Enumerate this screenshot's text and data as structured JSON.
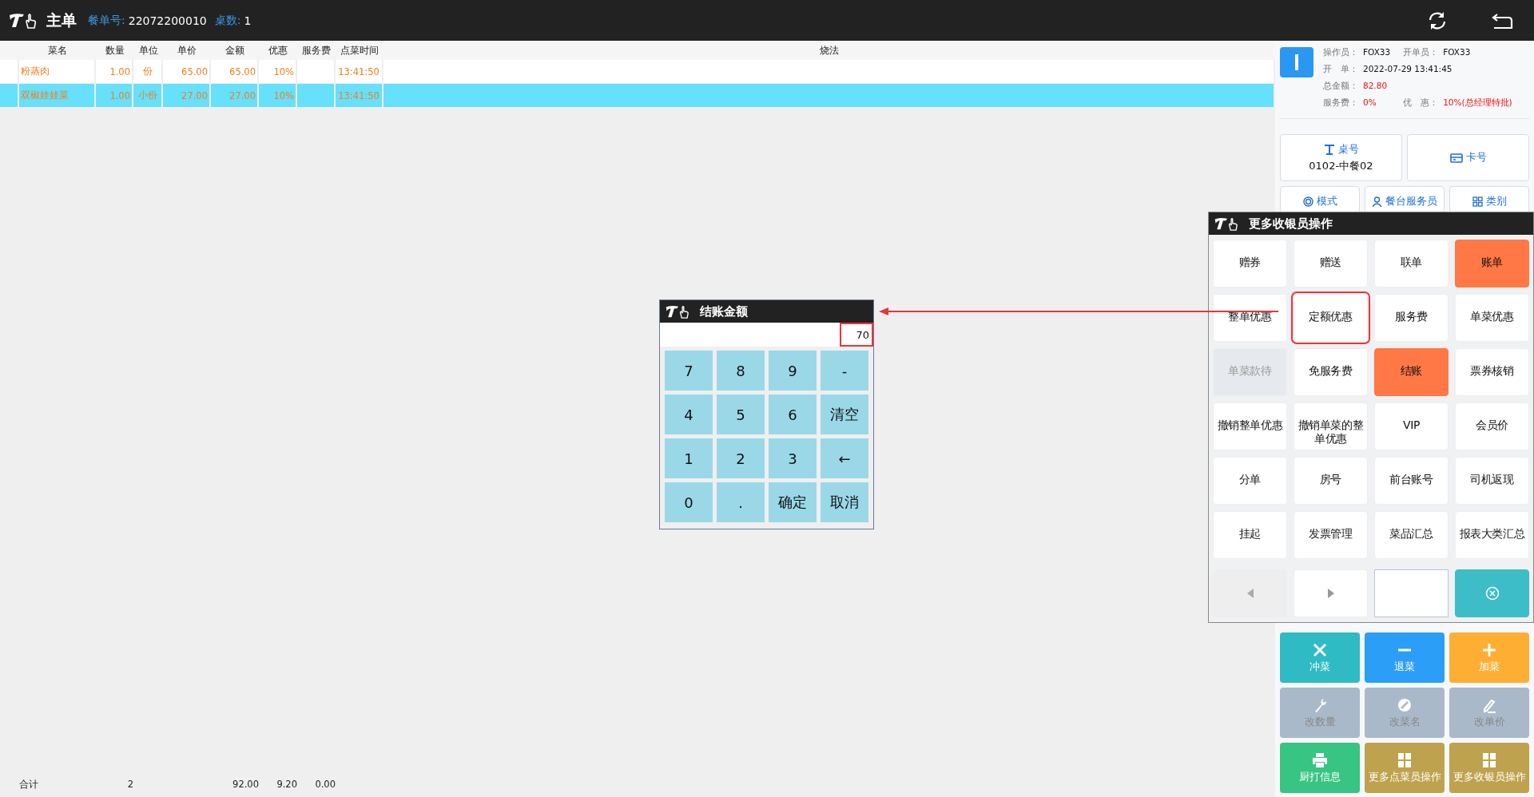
{
  "header": {
    "title": "主单",
    "order_label": "餐单号:",
    "order_no": "22072200010",
    "tables_label": "桌数:",
    "tables": "1"
  },
  "table": {
    "columns": [
      "菜名",
      "数量",
      "单位",
      "单价",
      "金额",
      "优惠",
      "服务费",
      "点菜时间",
      "烧法"
    ],
    "rows": [
      {
        "cells": [
          "粉蒸肉",
          "1.00",
          "份",
          "65.00",
          "65.00",
          "10%",
          "",
          "13:41:50",
          ""
        ],
        "selected": false
      },
      {
        "cells": [
          "双椒娃娃菜",
          "1.00",
          "小份",
          "27.00",
          "27.00",
          "10%",
          "",
          "13:41:50",
          ""
        ],
        "selected": true
      }
    ]
  },
  "totals": {
    "label": "合计",
    "quantity": "2",
    "amount": "92.00",
    "discount": "9.20",
    "service": "0.00"
  },
  "info": [
    {
      "label": "操作员：",
      "value": "FOX33",
      "alert": false
    },
    {
      "label": "开单员：",
      "value": "FOX33",
      "alert": false
    },
    {
      "label": "开　单：",
      "value": "2022-07-29 13:41:45",
      "alert": false
    },
    {
      "label": "总金额：",
      "value": "82.80",
      "alert": true
    },
    {
      "label": "服务费：",
      "value": "0%",
      "alert": true
    },
    {
      "label": "优　惠：",
      "value": "10%(总经理特批)",
      "alert": true
    }
  ],
  "table_button": {
    "label": "桌号",
    "value": "0102-中餐02"
  },
  "card_button": {
    "label": "卡号"
  },
  "mode_buttons": [
    {
      "label": "模式",
      "kind": "target"
    },
    {
      "label": "餐台服务员",
      "kind": "person"
    },
    {
      "label": "类别",
      "kind": "grid"
    }
  ],
  "actions": [
    {
      "label": "冲菜",
      "kind": "x",
      "color": "#2ebbc4",
      "disabled": false
    },
    {
      "label": "退菜",
      "kind": "minus",
      "color": "#2b9ef8",
      "disabled": false
    },
    {
      "label": "加菜",
      "kind": "plus",
      "color": "#ffae34",
      "disabled": false
    },
    {
      "label": "改数量",
      "kind": "wrench",
      "color": "#aab9ca",
      "disabled": true
    },
    {
      "label": "改菜名",
      "kind": "edit",
      "color": "#aab9ca",
      "disabled": true
    },
    {
      "label": "改单价",
      "kind": "pen",
      "color": "#aab9ca",
      "disabled": true
    },
    {
      "label": "厨打信息",
      "kind": "printer",
      "color": "#38c482",
      "disabled": false
    },
    {
      "label": "更多点菜员操作",
      "kind": "grid",
      "color": "#bfa24e",
      "disabled": false
    },
    {
      "label": "更多收银员操作",
      "kind": "grid",
      "color": "#bfa24e",
      "disabled": false
    }
  ],
  "cashier_popup": {
    "title": "更多收银员操作",
    "buttons": [
      {
        "label": "赠券",
        "kind": "plain",
        "highlighted": false
      },
      {
        "label": "赠送",
        "kind": "plain",
        "highlighted": false
      },
      {
        "label": "联单",
        "kind": "plain",
        "highlighted": false
      },
      {
        "label": "账单",
        "kind": "accent",
        "highlighted": false
      },
      {
        "label": "整单优惠",
        "kind": "plain",
        "highlighted": false
      },
      {
        "label": "定额优惠",
        "kind": "plain",
        "highlighted": true
      },
      {
        "label": "服务费",
        "kind": "plain",
        "highlighted": false
      },
      {
        "label": "单菜优惠",
        "kind": "plain",
        "highlighted": false
      },
      {
        "label": "单菜款待",
        "kind": "disabled",
        "highlighted": false
      },
      {
        "label": "免服务费",
        "kind": "plain",
        "highlighted": false
      },
      {
        "label": "结账",
        "kind": "accent",
        "highlighted": false
      },
      {
        "label": "票券核销",
        "kind": "plain",
        "highlighted": false
      },
      {
        "label": "撤销整单优惠",
        "kind": "plain",
        "highlighted": false
      },
      {
        "label": "撤销单菜的整单优惠",
        "kind": "plain",
        "highlighted": false
      },
      {
        "label": "VIP",
        "kind": "plain",
        "highlighted": false
      },
      {
        "label": "会员价",
        "kind": "plain",
        "highlighted": false
      },
      {
        "label": "分单",
        "kind": "plain",
        "highlighted": false
      },
      {
        "label": "房号",
        "kind": "plain",
        "highlighted": false
      },
      {
        "label": "前台账号",
        "kind": "plain",
        "highlighted": false
      },
      {
        "label": "司机返现",
        "kind": "plain",
        "highlighted": false
      },
      {
        "label": "挂起",
        "kind": "plain",
        "highlighted": false
      },
      {
        "label": "发票管理",
        "kind": "plain",
        "highlighted": false
      },
      {
        "label": "菜品汇总",
        "kind": "plain",
        "highlighted": false
      },
      {
        "label": "报表大类汇总",
        "kind": "plain",
        "highlighted": false
      }
    ]
  },
  "keypad": {
    "title": "结账金额",
    "value": "70",
    "highlighted": true,
    "keys": [
      "7",
      "8",
      "9",
      "-",
      "4",
      "5",
      "6",
      "清空",
      "1",
      "2",
      "3",
      "←",
      "0",
      ".",
      "确定",
      "取消"
    ]
  }
}
